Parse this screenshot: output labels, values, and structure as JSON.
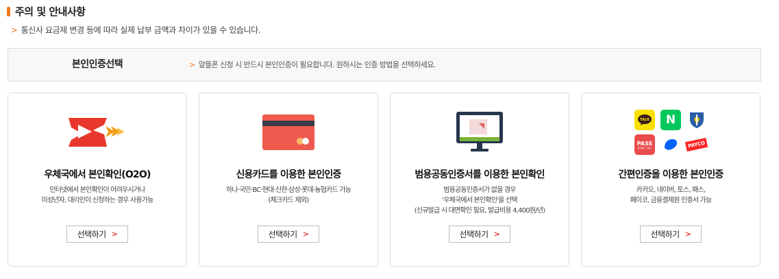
{
  "notice": {
    "title": "주의 및 안내사항",
    "arrow": ">",
    "line": "통신사 요금제 변경 등에 따라 실제 납부 금액과 차이가 있을 수 있습니다."
  },
  "auth": {
    "label": "본인인증선택",
    "arrow": ">",
    "description": "알뜰폰 신청 시 반드시 본인인증이 필요합니다. 원하시는 인증 방법을 선택하세요."
  },
  "select_label": "선택하기",
  "chevron": ">",
  "cards": [
    {
      "icon": "post-office-icon",
      "title": "우체국에서 본인확인(O2O)",
      "desc": [
        "인터넷에서 본인확인이 어려우시거나",
        "미성년자, 대리인이 신청하는 경우 사용가능"
      ]
    },
    {
      "icon": "credit-card-icon",
      "title": "신용카드를 이용한 본인인증",
      "desc": [
        "하나·국민·BC·현대·신한·삼성·롯데·농협카드 가능",
        "(체크카드 제외)"
      ]
    },
    {
      "icon": "certificate-monitor-icon",
      "title": "범용공동인증서를 이용한 본인확인",
      "desc": [
        "범용공동인증서가 없을 경우",
        "'우체국에서 본인확인'을 선택",
        "(신규발급 시 대면확인 필요, 발급비용 4,400원/년)"
      ]
    },
    {
      "icon": "simple-auth-icons",
      "title": "간편인증을 이용한 본인인증",
      "desc": [
        "카카오, 네이버, 토스, 패스,",
        "페이코, 금융결제원 인증서 가능"
      ],
      "logos": {
        "kakao": "TALK",
        "naver": "N",
        "pass": "PASS",
        "pass_sub": "본인확인 인증서",
        "payco": "PAYCO"
      }
    }
  ],
  "colors": {
    "accent": "#f0781e",
    "chevron": "#e0322a",
    "post_red": "#e8382b",
    "card_red": "#ef5a4e",
    "monitor_navy": "#27364d",
    "monitor_green": "#7bb33a",
    "kakao": "#f9e000",
    "naver": "#03c75a",
    "pass": "#ea4b4b",
    "toss": "#0064ff",
    "payco": "#fa2828"
  }
}
